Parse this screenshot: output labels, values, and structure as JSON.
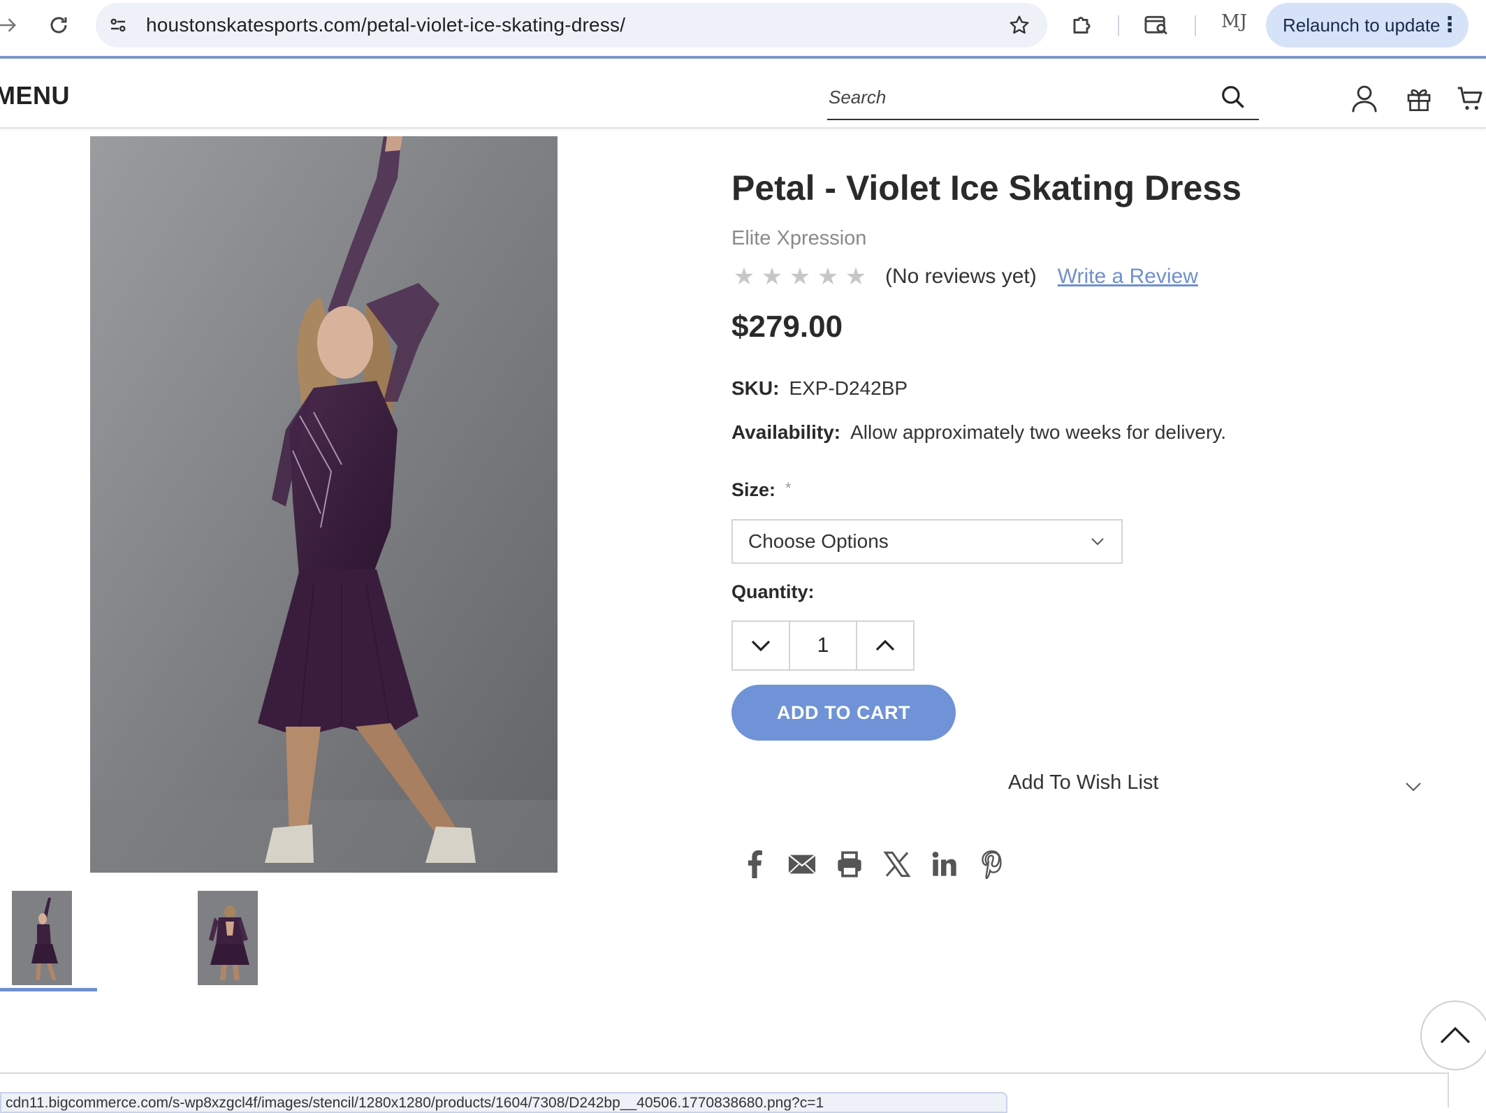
{
  "browser": {
    "url": "houstonskatesports.com/petal-violet-ice-skating-dress/",
    "profile_initials": "MJ",
    "relaunch_label": "Relaunch to update",
    "status_url": "cdn11.bigcommerce.com/s-wp8xzgcl4f/images/stencil/1280x1280/products/1604/7308/D242bp__40506.1770838680.png?c=1"
  },
  "header": {
    "menu_label": "MENU",
    "search_placeholder": "Search"
  },
  "product": {
    "title": "Petal - Violet Ice Skating Dress",
    "brand": "Elite Xpression",
    "rating_stars": 0,
    "reviews_text": "(No reviews yet)",
    "write_review_label": "Write a Review",
    "price": "$279.00",
    "sku_label": "SKU:",
    "sku_value": "EXP-D242BP",
    "availability_label": "Availability:",
    "availability_value": "Allow approximately two weeks for delivery.",
    "size_label": "Size:",
    "size_required_mark": "*",
    "size_selected": "Choose Options",
    "quantity_label": "Quantity:",
    "quantity_value": "1",
    "add_to_cart_label": "ADD TO CART",
    "wishlist_label": "Add To Wish List"
  },
  "gallery": {
    "thumbnail_count": 2,
    "active_thumbnail": 0
  },
  "share_icons": [
    "facebook-icon",
    "email-icon",
    "print-icon",
    "x-icon",
    "linkedin-icon",
    "pinterest-icon"
  ],
  "colors": {
    "accent": "#6f93d6",
    "link": "#6f8fd0",
    "dress": "#3d1f3f"
  }
}
